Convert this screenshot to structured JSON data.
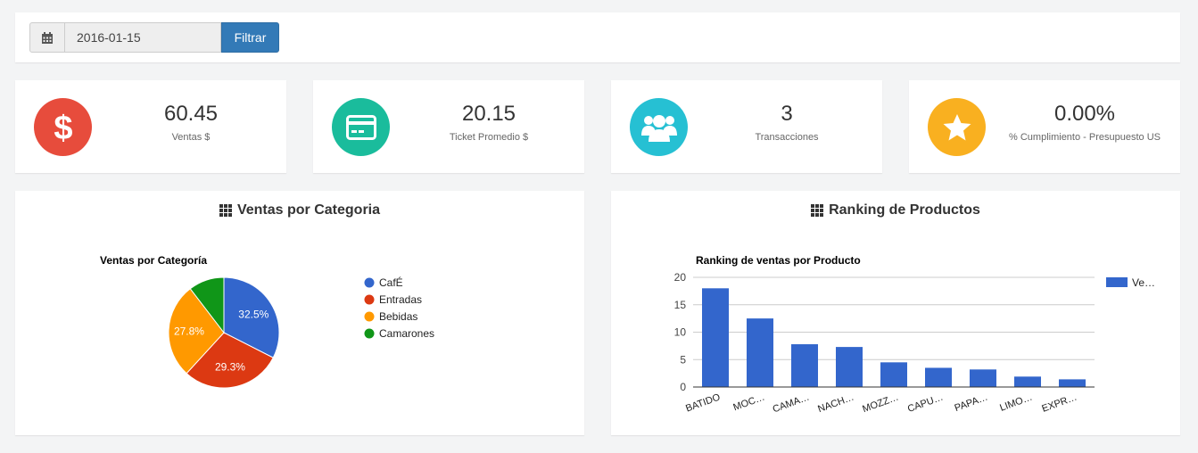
{
  "filter": {
    "date_value": "2016-01-15",
    "button_label": "Filtrar",
    "calendar_icon": "calendar-icon"
  },
  "stats": [
    {
      "value": "60.45",
      "label": "Ventas $",
      "icon": "dollar-icon",
      "color": "#e74c3c"
    },
    {
      "value": "20.15",
      "label": "Ticket Promedio $",
      "icon": "credit-card-icon",
      "color": "#1abc9c"
    },
    {
      "value": "3",
      "label": "Transacciones",
      "icon": "users-icon",
      "color": "#26c0d3"
    },
    {
      "value": "0.00%",
      "label": "% Cumplimiento - Presupuesto US",
      "icon": "star-icon",
      "color": "#f9b020"
    }
  ],
  "category_panel": {
    "title": "Ventas por Categoria",
    "title_icon": "grid-icon"
  },
  "ranking_panel": {
    "title": "Ranking de Productos",
    "title_icon": "grid-icon"
  },
  "chart_data": [
    {
      "type": "pie",
      "title": "Ventas por Categoría",
      "categories": [
        "CafÉ",
        "Entradas",
        "Bebidas",
        "Camarones"
      ],
      "values": [
        32.5,
        29.3,
        27.8,
        10.4
      ],
      "labels": [
        "32.5%",
        "29.3%",
        "27.8%",
        ""
      ],
      "colors": [
        "#3366cc",
        "#dc3912",
        "#ff9900",
        "#109618"
      ],
      "legend": "right"
    },
    {
      "type": "bar",
      "title": "Ranking de ventas por Producto",
      "categories": [
        "BATIDO",
        "MOC…",
        "CAMA…",
        "NACH…",
        "MOZZ…",
        "CAPU…",
        "PAPA…",
        "LIMO…",
        "EXPR…"
      ],
      "series": [
        {
          "name": "Ve…",
          "values": [
            18,
            12.5,
            7.8,
            7.3,
            4.5,
            3.5,
            3.2,
            1.9,
            1.4
          ],
          "color": "#3366cc"
        }
      ],
      "ylim": [
        0,
        20
      ],
      "yticks": [
        0,
        5,
        10,
        15,
        20
      ],
      "grid": true,
      "legend": "right"
    }
  ]
}
